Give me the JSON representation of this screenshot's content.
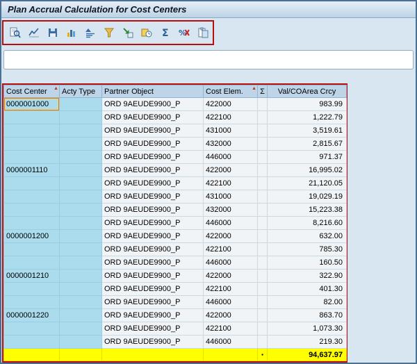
{
  "window": {
    "title": "Plan Accrual Calculation for Cost Centers"
  },
  "toolbar": {
    "icons": [
      {
        "name": "details"
      },
      {
        "name": "graphic"
      },
      {
        "name": "save"
      },
      {
        "name": "column-chart"
      },
      {
        "name": "sort-ascending"
      },
      {
        "name": "filter"
      },
      {
        "name": "drilldown"
      },
      {
        "name": "history"
      },
      {
        "name": "sum"
      },
      {
        "name": "percentage"
      },
      {
        "name": "copy"
      }
    ]
  },
  "selection_bar": {
    "value": "",
    "placeholder": ""
  },
  "table": {
    "sort_indicator": "▲",
    "columns": [
      {
        "label": "Cost Center",
        "sorted": true
      },
      {
        "label": "Acty Type",
        "sorted": false
      },
      {
        "label": "Partner Object",
        "sorted": false
      },
      {
        "label": "Cost Elem.",
        "sorted": true
      },
      {
        "label": "Σ",
        "sorted": false
      },
      {
        "label": "Val/COArea Crcy",
        "sorted": false
      }
    ],
    "rows": [
      {
        "cost_center": "0000001000",
        "acty_type": "",
        "partner_object": "ORD 9AEUDE9900_P",
        "cost_elem": "422000",
        "value": "983.99",
        "selected": true
      },
      {
        "cost_center": "",
        "acty_type": "",
        "partner_object": "ORD 9AEUDE9900_P",
        "cost_elem": "422100",
        "value": "1,222.79",
        "selected": false
      },
      {
        "cost_center": "",
        "acty_type": "",
        "partner_object": "ORD 9AEUDE9900_P",
        "cost_elem": "431000",
        "value": "3,519.61",
        "selected": false
      },
      {
        "cost_center": "",
        "acty_type": "",
        "partner_object": "ORD 9AEUDE9900_P",
        "cost_elem": "432000",
        "value": "2,815.67",
        "selected": false
      },
      {
        "cost_center": "",
        "acty_type": "",
        "partner_object": "ORD 9AEUDE9900_P",
        "cost_elem": "446000",
        "value": "971.37",
        "selected": false
      },
      {
        "cost_center": "0000001110",
        "acty_type": "",
        "partner_object": "ORD 9AEUDE9900_P",
        "cost_elem": "422000",
        "value": "16,995.02",
        "selected": false
      },
      {
        "cost_center": "",
        "acty_type": "",
        "partner_object": "ORD 9AEUDE9900_P",
        "cost_elem": "422100",
        "value": "21,120.05",
        "selected": false
      },
      {
        "cost_center": "",
        "acty_type": "",
        "partner_object": "ORD 9AEUDE9900_P",
        "cost_elem": "431000",
        "value": "19,029.19",
        "selected": false
      },
      {
        "cost_center": "",
        "acty_type": "",
        "partner_object": "ORD 9AEUDE9900_P",
        "cost_elem": "432000",
        "value": "15,223.38",
        "selected": false
      },
      {
        "cost_center": "",
        "acty_type": "",
        "partner_object": "ORD 9AEUDE9900_P",
        "cost_elem": "446000",
        "value": "8,216.60",
        "selected": false
      },
      {
        "cost_center": "0000001200",
        "acty_type": "",
        "partner_object": "ORD 9AEUDE9900_P",
        "cost_elem": "422000",
        "value": "632.00",
        "selected": false
      },
      {
        "cost_center": "",
        "acty_type": "",
        "partner_object": "ORD 9AEUDE9900_P",
        "cost_elem": "422100",
        "value": "785.30",
        "selected": false
      },
      {
        "cost_center": "",
        "acty_type": "",
        "partner_object": "ORD 9AEUDE9900_P",
        "cost_elem": "446000",
        "value": "160.50",
        "selected": false
      },
      {
        "cost_center": "0000001210",
        "acty_type": "",
        "partner_object": "ORD 9AEUDE9900_P",
        "cost_elem": "422000",
        "value": "322.90",
        "selected": false
      },
      {
        "cost_center": "",
        "acty_type": "",
        "partner_object": "ORD 9AEUDE9900_P",
        "cost_elem": "422100",
        "value": "401.30",
        "selected": false
      },
      {
        "cost_center": "",
        "acty_type": "",
        "partner_object": "ORD 9AEUDE9900_P",
        "cost_elem": "446000",
        "value": "82.00",
        "selected": false
      },
      {
        "cost_center": "0000001220",
        "acty_type": "",
        "partner_object": "ORD 9AEUDE9900_P",
        "cost_elem": "422000",
        "value": "863.70",
        "selected": false
      },
      {
        "cost_center": "",
        "acty_type": "",
        "partner_object": "ORD 9AEUDE9900_P",
        "cost_elem": "422100",
        "value": "1,073.30",
        "selected": false
      },
      {
        "cost_center": "",
        "acty_type": "",
        "partner_object": "ORD 9AEUDE9900_P",
        "cost_elem": "446000",
        "value": "219.30",
        "selected": false
      }
    ],
    "total": {
      "marker": "▪",
      "value": "94,637.97"
    }
  }
}
